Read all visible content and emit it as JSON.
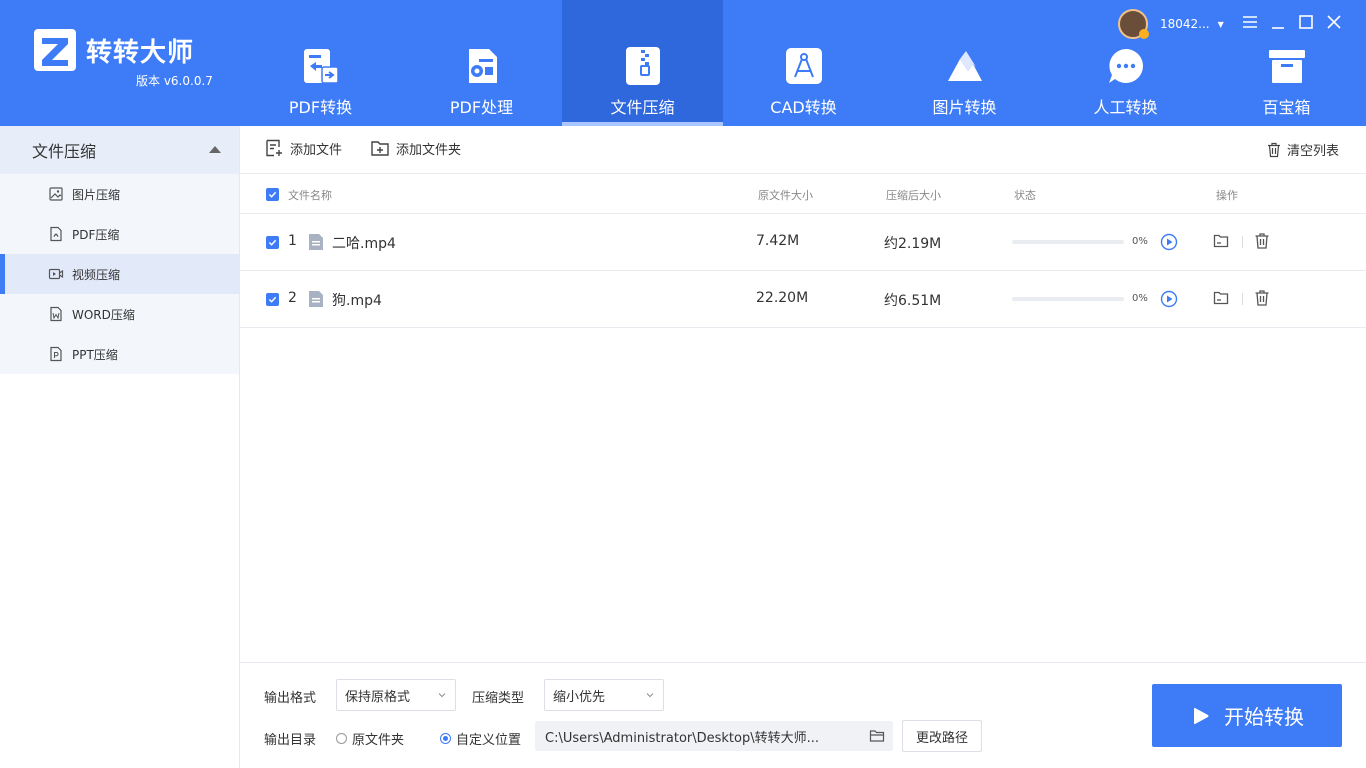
{
  "brand": {
    "name": "转转大师",
    "version": "版本 v6.0.0.7"
  },
  "user": {
    "name": "18042..."
  },
  "tabs": [
    {
      "label": "PDF转换",
      "icon": "pdf-convert-icon"
    },
    {
      "label": "PDF处理",
      "icon": "pdf-process-icon"
    },
    {
      "label": "文件压缩",
      "icon": "zip-icon",
      "active": true
    },
    {
      "label": "CAD转换",
      "icon": "cad-icon"
    },
    {
      "label": "图片转换",
      "icon": "image-icon"
    },
    {
      "label": "人工转换",
      "icon": "chat-icon"
    },
    {
      "label": "百宝箱",
      "icon": "toolbox-icon"
    }
  ],
  "sidebar": {
    "title": "文件压缩",
    "items": [
      {
        "label": "图片压缩",
        "icon": "image-icon"
      },
      {
        "label": "PDF压缩",
        "icon": "pdf-icon"
      },
      {
        "label": "视频压缩",
        "icon": "video-icon",
        "active": true
      },
      {
        "label": "WORD压缩",
        "icon": "word-icon"
      },
      {
        "label": "PPT压缩",
        "icon": "ppt-icon"
      }
    ]
  },
  "toolbar": {
    "add_file": "添加文件",
    "add_folder": "添加文件夹",
    "clear_list": "清空列表"
  },
  "table": {
    "headers": {
      "name": "文件名称",
      "orig_size": "原文件大小",
      "comp_size": "压缩后大小",
      "status": "状态",
      "ops": "操作"
    },
    "rows": [
      {
        "index": "1",
        "name": "二哈.mp4",
        "orig_size": "7.42M",
        "comp_size": "约2.19M",
        "progress": "0%"
      },
      {
        "index": "2",
        "name": "狗.mp4",
        "orig_size": "22.20M",
        "comp_size": "约6.51M",
        "progress": "0%"
      }
    ]
  },
  "bottom": {
    "format_label": "输出格式",
    "format_value": "保持原格式",
    "ctype_label": "压缩类型",
    "ctype_value": "缩小优先",
    "dir_label": "输出目录",
    "radio_original": "原文件夹",
    "radio_custom": "自定义位置",
    "path": "C:\\Users\\Administrator\\Desktop\\转转大师...",
    "change_path": "更改路径",
    "start": "开始转换"
  },
  "colors": {
    "brand": "#3d7bf7",
    "tab_active": "#2f67dc",
    "sidebar_head": "#e7eefa"
  }
}
